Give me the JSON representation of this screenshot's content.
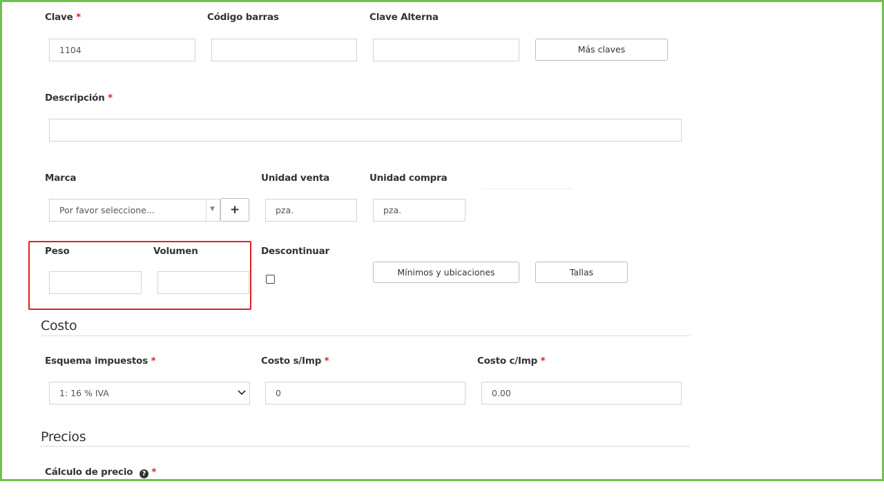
{
  "fields": {
    "clave": {
      "label": "Clave",
      "required_mark": "*",
      "value": "1104"
    },
    "codigo_barras": {
      "label": "Código barras",
      "value": ""
    },
    "clave_alterna": {
      "label": "Clave Alterna",
      "value": ""
    },
    "descripcion": {
      "label": "Descripción",
      "required_mark": "*",
      "value": ""
    },
    "marca": {
      "label": "Marca",
      "selected": "Por favor seleccione..."
    },
    "unidad_venta": {
      "label": "Unidad venta",
      "value": "pza."
    },
    "unidad_compra": {
      "label": "Unidad compra",
      "value": "pza."
    },
    "peso": {
      "label": "Peso",
      "value": ""
    },
    "volumen": {
      "label": "Volumen",
      "value": ""
    },
    "descontinuar": {
      "label": "Descontinuar",
      "checked": false
    },
    "esquema_impuestos": {
      "label": "Esquema impuestos",
      "required_mark": "*",
      "selected": "1: 16 % IVA"
    },
    "costo_sin_imp": {
      "label": "Costo s/Imp",
      "required_mark": "*",
      "value": "0"
    },
    "costo_con_imp": {
      "label": "Costo c/Imp",
      "required_mark": "*",
      "value": "0.00"
    },
    "calculo_precio": {
      "label": "Cálculo de precio",
      "required_mark": "*",
      "help_icon": "question-circle-icon"
    }
  },
  "buttons": {
    "mas_claves": "Más claves",
    "marca_add": "+",
    "minimos_ubicaciones": "Mínimos y ubicaciones",
    "tallas": "Tallas"
  },
  "sections": {
    "costo": "Costo",
    "precios": "Precios"
  },
  "colors": {
    "frame_border": "#6cc24a",
    "highlight_border": "#e02020",
    "required": "#dd2222"
  }
}
